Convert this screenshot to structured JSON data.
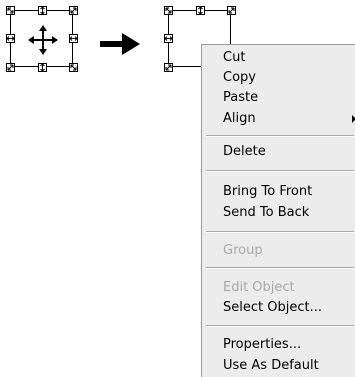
{
  "menu": {
    "items": [
      {
        "label": "Cut",
        "enabled": true
      },
      {
        "label": "Copy",
        "enabled": true
      },
      {
        "label": "Paste",
        "enabled": true
      },
      {
        "label": "Align",
        "enabled": true,
        "has_submenu": true
      },
      {
        "label": "Delete",
        "enabled": true
      },
      {
        "label": "Bring To Front",
        "enabled": true
      },
      {
        "label": "Send To Back",
        "enabled": true
      },
      {
        "label": "Group",
        "enabled": false
      },
      {
        "label": "Edit Object",
        "enabled": false
      },
      {
        "label": "Select Object...",
        "enabled": true
      },
      {
        "label": "Properties...",
        "enabled": true
      },
      {
        "label": "Use As Default",
        "enabled": true
      }
    ]
  },
  "icons": {
    "move_cursor": "four-way-move-arrow-icon",
    "transition": "right-arrow-icon",
    "resize_handles": "resize-handle-icon"
  },
  "colors": {
    "menu_background": "#ececec",
    "disabled_text": "#a8a8a8"
  }
}
